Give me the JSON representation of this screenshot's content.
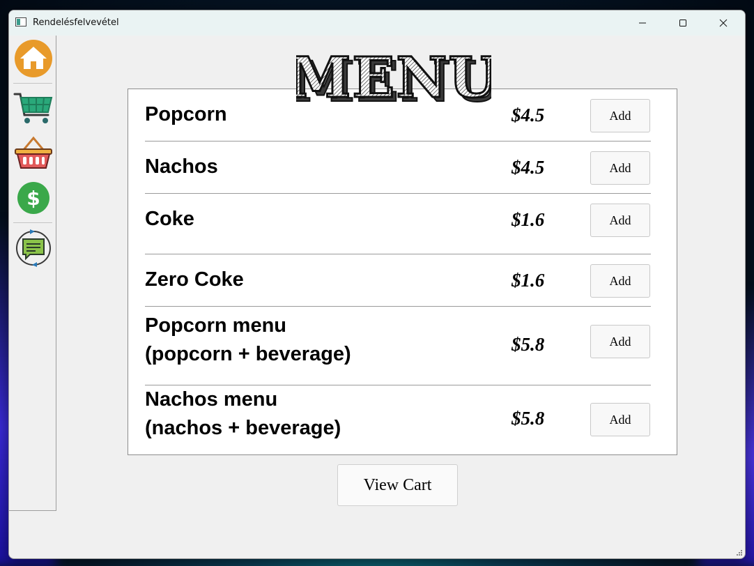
{
  "window": {
    "title": "Rendelésfelvevétel"
  },
  "menu_header": {
    "text": "MENU"
  },
  "items": [
    {
      "name": "Popcorn",
      "price": "$4.5",
      "add_label": "Add"
    },
    {
      "name": "Nachos",
      "price": "$4.5",
      "add_label": "Add"
    },
    {
      "name": "Coke",
      "price": "$1.6",
      "add_label": "Add"
    },
    {
      "name": "Zero Coke",
      "price": "$1.6",
      "add_label": "Add"
    },
    {
      "name": "Popcorn menu\n(popcorn + beverage)",
      "price": "$5.8",
      "add_label": "Add"
    },
    {
      "name": "Nachos menu\n(nachos + beverage)",
      "price": "$5.8",
      "add_label": "Add"
    }
  ],
  "view_cart_label": "View Cart",
  "sidebar": {
    "items": [
      {
        "icon": "home-icon"
      },
      {
        "icon": "shopping-cart-icon"
      },
      {
        "icon": "shopping-basket-icon"
      },
      {
        "icon": "dollar-icon"
      },
      {
        "icon": "feedback-chat-icon"
      }
    ]
  },
  "colors": {
    "home_orange": "#e89a2a",
    "cart_green": "#2aa87a",
    "basket_red": "#e25a5a",
    "dollar_green": "#3aa84a",
    "chat_green": "#8bc34a"
  }
}
